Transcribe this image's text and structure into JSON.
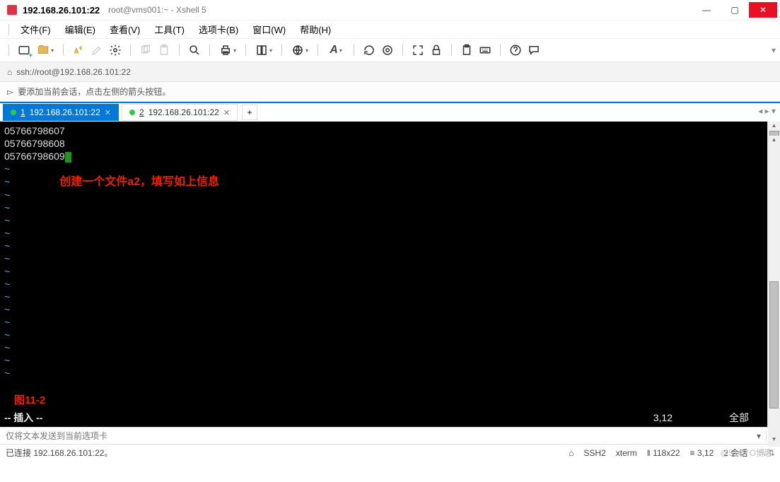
{
  "title": {
    "host": "192.168.26.101:22",
    "sub": "root@vms001:~ - Xshell 5"
  },
  "menus": {
    "file": "文件(F)",
    "edit": "编辑(E)",
    "view": "查看(V)",
    "tools": "工具(T)",
    "tabs": "选项卡(B)",
    "window": "窗口(W)",
    "help": "帮助(H)"
  },
  "address": {
    "url": "ssh://root@192.168.26.101:22"
  },
  "hint": {
    "text": "要添加当前会话，点击左侧的箭头按钮。"
  },
  "tabs": {
    "items": [
      {
        "num": "1",
        "label": "192.168.26.101:22",
        "active": true
      },
      {
        "num": "2",
        "label": "192.168.26.101:22",
        "active": false
      }
    ],
    "nav": "◂ ▸ ▾"
  },
  "terminal": {
    "lines": [
      "05766798607",
      "05766798608",
      "05766798609"
    ],
    "tilde": "~",
    "annotation": "创建一个文件a2，填写如上信息",
    "figure": "图11-2",
    "mode": "-- 插入 --",
    "position": "3,12",
    "scope": "全部"
  },
  "inputbar": {
    "placeholder": "仅将文本发送到当前选项卡"
  },
  "status": {
    "connected": "已连接 192.168.26.101:22。",
    "proto": "SSH2",
    "term": "xterm",
    "size": "118x22",
    "pos": "3,12",
    "sessions": "2 会话",
    "arrows": "↑ ↓ ⇅",
    "watermark": "@51CTO博客",
    "lock_icon": "⌂"
  }
}
